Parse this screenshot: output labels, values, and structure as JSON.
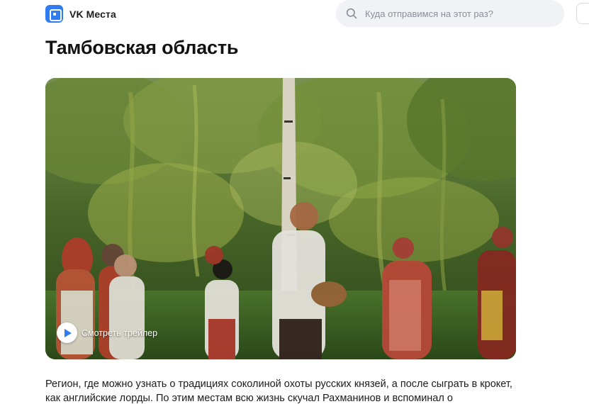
{
  "header": {
    "logo_text": "VK Места",
    "search": {
      "placeholder": "Куда отправимся на этот раз?",
      "value": ""
    }
  },
  "page": {
    "title": "Тамбовская область",
    "hero": {
      "trailer_label": "Смотреть трейлер",
      "image_content": "folk-festival-birch-grove"
    },
    "description": "Регион, где можно узнать о традициях соколиной охоты русских князей, а после сыграть в крокет, как английские лорды. По этим местам всю жизнь скучал Рахманинов и вспоминал о"
  },
  "colors": {
    "accent": "#2f7bf0",
    "search_bg": "#f0f2f5",
    "text": "#1b1b1f",
    "placeholder": "#8a8f99"
  },
  "icons": {
    "logo": "vk-places-logo-icon",
    "search": "search-icon",
    "play": "play-icon"
  }
}
